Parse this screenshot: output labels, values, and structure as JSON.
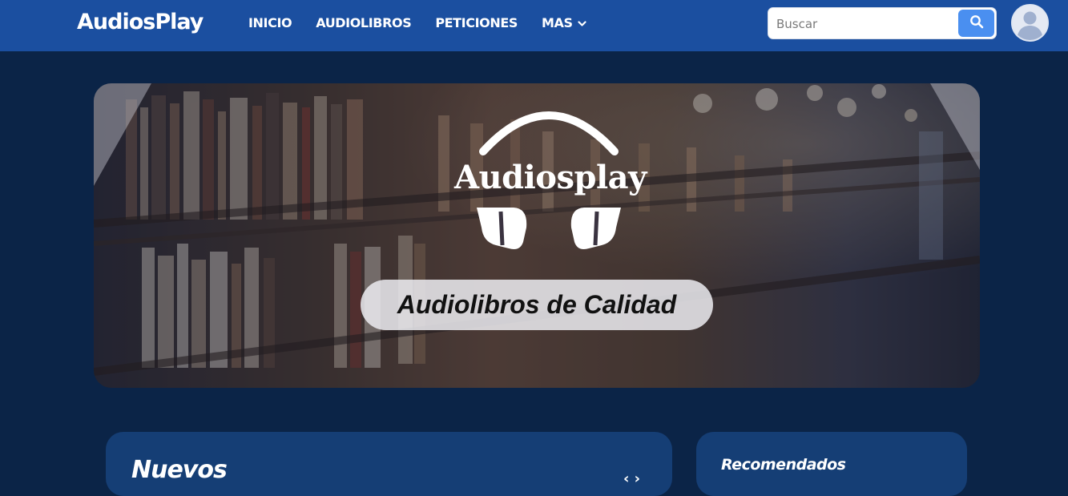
{
  "brand": "AudiosPlay",
  "nav": {
    "items": [
      {
        "label": "INICIO"
      },
      {
        "label": "AUDIOLIBROS"
      },
      {
        "label": "PETICIONES"
      },
      {
        "label": "MAS",
        "icon": "chevron-down-icon"
      }
    ]
  },
  "search": {
    "placeholder": "Buscar",
    "value": "",
    "button_icon": "search-icon"
  },
  "user": {
    "avatar_icon": "user-avatar-icon"
  },
  "hero": {
    "logo_text": "Audiosplay",
    "logo_icon": "headphones-icon",
    "tagline": "Audiolibros de Calidad"
  },
  "sections": {
    "nuevos": {
      "title": "Nuevos",
      "nav_hint": "‹ ›"
    },
    "recomendados": {
      "title": "Recomendados"
    }
  },
  "colors": {
    "navbar": "#1b4fa0",
    "page_bg": "#0b2447",
    "card_bg": "#153e75",
    "search_button": "#4a8ff0"
  }
}
